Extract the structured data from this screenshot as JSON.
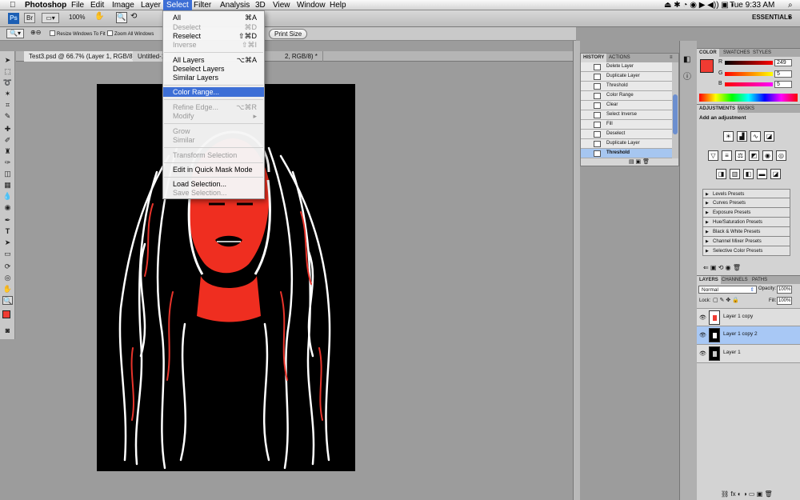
{
  "menubar": {
    "items": [
      "Photoshop",
      "File",
      "Edit",
      "Image",
      "Layer",
      "Select",
      "Filter",
      "Analysis",
      "3D",
      "View",
      "Window",
      "Help"
    ],
    "active": "Select",
    "clock": "Tue 9:33 AM"
  },
  "optionsbar": {
    "zoom": "100%",
    "essentials": "ESSENTIALS",
    "resize_windows": "Resize Windows To Fit",
    "zoom_all": "Zoom All Windows",
    "print_size": "Print Size"
  },
  "tabs": [
    {
      "label": "Test3.psd @ 66.7% (Layer 1, RGB/8) *"
    },
    {
      "label": "Untitled-1"
    },
    {
      "label": "2, RGB/8) *"
    }
  ],
  "select_menu": [
    {
      "label": "All",
      "shortcut": "⌘A",
      "enabled": true
    },
    {
      "label": "Deselect",
      "shortcut": "⌘D",
      "enabled": false
    },
    {
      "label": "Reselect",
      "shortcut": "⇧⌘D",
      "enabled": true
    },
    {
      "label": "Inverse",
      "shortcut": "⇧⌘I",
      "enabled": false
    },
    {
      "label": "All Layers",
      "shortcut": "⌥⌘A",
      "enabled": true
    },
    {
      "label": "Deselect Layers",
      "shortcut": "",
      "enabled": true
    },
    {
      "label": "Similar Layers",
      "shortcut": "",
      "enabled": true
    },
    {
      "label": "Color Range...",
      "shortcut": "",
      "enabled": true,
      "highlighted": true
    },
    {
      "label": "Refine Edge...",
      "shortcut": "⌥⌘R",
      "enabled": false
    },
    {
      "label": "Modify",
      "shortcut": "▸",
      "enabled": false
    },
    {
      "label": "Grow",
      "shortcut": "",
      "enabled": false
    },
    {
      "label": "Similar",
      "shortcut": "",
      "enabled": false
    },
    {
      "label": "Transform Selection",
      "shortcut": "",
      "enabled": false
    },
    {
      "label": "Edit in Quick Mask Mode",
      "shortcut": "",
      "enabled": true
    },
    {
      "label": "Load Selection...",
      "shortcut": "",
      "enabled": true
    },
    {
      "label": "Save Selection...",
      "shortcut": "",
      "enabled": false
    }
  ],
  "history": {
    "tabs": [
      "HISTORY",
      "ACTIONS"
    ],
    "items": [
      "Delete Layer",
      "Duplicate Layer",
      "Threshold",
      "Color Range",
      "Clear",
      "Select Inverse",
      "Fill",
      "Deselect",
      "Duplicate Layer",
      "Threshold"
    ],
    "active_index": 9
  },
  "color_panel": {
    "tabs": [
      "COLOR",
      "SWATCHES",
      "STYLES"
    ],
    "r_label": "R",
    "g_label": "G",
    "b_label": "B",
    "r": "249",
    "g": "5",
    "b": "5",
    "fg_color": "#f90505"
  },
  "adjustments": {
    "tabs": [
      "ADJUSTMENTS",
      "MASKS"
    ],
    "heading": "Add an adjustment",
    "presets": [
      "Levels Presets",
      "Curves Presets",
      "Exposure Presets",
      "Hue/Saturation Presets",
      "Black & White Presets",
      "Channel Mixer Presets",
      "Selective Color Presets"
    ]
  },
  "layers": {
    "tabs": [
      "LAYERS",
      "CHANNELS",
      "PATHS"
    ],
    "blend_mode": "Normal",
    "opacity_label": "Opacity:",
    "opacity": "100%",
    "lock_label": "Lock:",
    "fill_label": "Fill:",
    "fill": "100%",
    "items": [
      {
        "name": "Layer 1 copy",
        "active": false
      },
      {
        "name": "Layer 1 copy 2",
        "active": true
      },
      {
        "name": "Layer 1",
        "active": false
      }
    ]
  }
}
